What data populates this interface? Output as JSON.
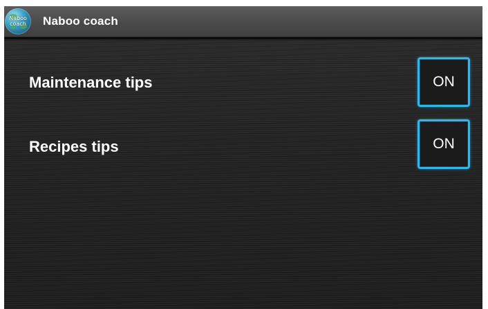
{
  "app": {
    "title": "Naboo coach",
    "icon_text_line1": "Naboo",
    "icon_text_line2": "coach",
    "icon": "globe-icon"
  },
  "settings": [
    {
      "label": "Maintenance tips",
      "toggle_label": "ON",
      "enabled": true
    },
    {
      "label": "Recipes tips",
      "toggle_label": "ON",
      "enabled": true
    }
  ],
  "colors": {
    "accent": "#33b5e5",
    "action_bar": "#4c4c4c",
    "background": "#262626",
    "text": "#ffffff"
  }
}
